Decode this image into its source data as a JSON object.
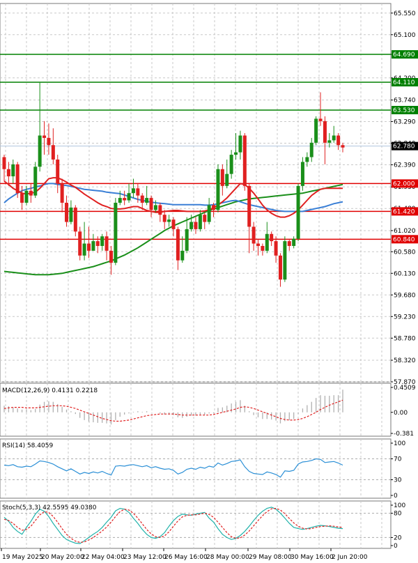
{
  "chart_data": {
    "type": "candlestick",
    "title": "",
    "price_axis": {
      "ticks": [
        "65.550",
        "65.100",
        "64.690",
        "64.200",
        "63.740",
        "63.290",
        "62.840",
        "62.390",
        "61.930",
        "61.480",
        "61.020",
        "60.580",
        "60.130",
        "59.680",
        "59.230",
        "58.780",
        "58.320",
        "57.870"
      ],
      "ylim": [
        57.87,
        65.75
      ]
    },
    "time_axis": {
      "labels": [
        "19 May 2025",
        "20 May 20:00",
        "22 May 04:00",
        "23 May 12:00",
        "26 May 16:00",
        "28 May 00:00",
        "29 May 08:00",
        "30 May 16:00",
        "2 Jun 20:00"
      ]
    },
    "horizontal_levels": [
      {
        "value": 64.69,
        "label": "64.690",
        "color": "#008000"
      },
      {
        "value": 64.11,
        "label": "64.110",
        "color": "#008000"
      },
      {
        "value": 63.53,
        "label": "63.530",
        "color": "#008000"
      },
      {
        "value": 62.0,
        "label": "62.000",
        "color": "#e00000"
      },
      {
        "value": 61.42,
        "label": "61.420",
        "color": "#e00000"
      },
      {
        "value": 60.84,
        "label": "60.840",
        "color": "#e00000"
      }
    ],
    "current_price": {
      "value": 62.78,
      "label": "62.780"
    },
    "candles": [
      [
        62.55,
        62.3,
        62.6,
        62.05
      ],
      [
        62.3,
        62.15,
        62.45,
        61.95
      ],
      [
        62.15,
        62.4,
        62.5,
        62.0
      ],
      [
        62.4,
        61.8,
        62.45,
        61.7
      ],
      [
        61.8,
        61.6,
        61.95,
        61.45
      ],
      [
        61.6,
        61.85,
        61.95,
        61.55
      ],
      [
        61.85,
        61.75,
        62.0,
        61.6
      ],
      [
        61.75,
        62.35,
        62.45,
        61.7
      ],
      [
        62.35,
        63.0,
        64.1,
        62.25
      ],
      [
        63.0,
        62.95,
        63.3,
        62.6
      ],
      [
        62.95,
        62.8,
        63.25,
        62.6
      ],
      [
        62.8,
        62.5,
        63.15,
        62.4
      ],
      [
        62.5,
        62.0,
        62.6,
        61.8
      ],
      [
        62.0,
        61.6,
        62.1,
        61.4
      ],
      [
        61.6,
        61.2,
        61.75,
        61.1
      ],
      [
        61.2,
        61.5,
        61.65,
        61.15
      ],
      [
        61.5,
        61.0,
        61.55,
        60.9
      ],
      [
        61.0,
        60.5,
        61.1,
        60.4
      ],
      [
        60.5,
        60.75,
        61.2,
        60.4
      ],
      [
        60.75,
        60.6,
        61.1,
        60.45
      ],
      [
        60.6,
        60.8,
        60.95,
        60.6
      ],
      [
        60.8,
        60.7,
        60.9,
        60.55
      ],
      [
        60.7,
        60.9,
        60.95,
        60.6
      ],
      [
        60.9,
        60.6,
        61.0,
        60.4
      ],
      [
        60.6,
        60.35,
        60.7,
        60.1
      ],
      [
        60.35,
        61.6,
        61.7,
        60.3
      ],
      [
        61.6,
        61.7,
        61.85,
        61.55
      ],
      [
        61.7,
        61.65,
        61.85,
        61.55
      ],
      [
        61.65,
        61.8,
        62.0,
        61.6
      ],
      [
        61.8,
        61.9,
        62.1,
        61.7
      ],
      [
        61.9,
        61.75,
        62.0,
        61.6
      ],
      [
        61.75,
        61.6,
        61.8,
        61.45
      ],
      [
        61.6,
        61.7,
        61.95,
        61.55
      ],
      [
        61.7,
        61.45,
        61.75,
        61.3
      ],
      [
        61.45,
        61.55,
        61.65,
        61.4
      ],
      [
        61.55,
        61.35,
        61.6,
        61.2
      ],
      [
        61.35,
        61.2,
        61.45,
        61.05
      ],
      [
        61.2,
        61.25,
        61.35,
        61.1
      ],
      [
        61.25,
        61.05,
        61.3,
        60.9
      ],
      [
        61.05,
        60.4,
        61.1,
        60.2
      ],
      [
        60.4,
        60.6,
        60.9,
        60.35
      ],
      [
        60.6,
        61.05,
        61.3,
        60.55
      ],
      [
        61.05,
        61.2,
        61.35,
        61.0
      ],
      [
        61.2,
        61.05,
        61.3,
        60.95
      ],
      [
        61.05,
        61.35,
        61.45,
        61.0
      ],
      [
        61.35,
        61.2,
        61.4,
        61.05
      ],
      [
        61.2,
        61.55,
        61.7,
        61.15
      ],
      [
        61.55,
        61.45,
        61.6,
        61.3
      ],
      [
        61.45,
        62.3,
        62.4,
        61.4
      ],
      [
        62.3,
        61.95,
        62.4,
        61.75
      ],
      [
        61.95,
        62.2,
        62.5,
        61.9
      ],
      [
        62.2,
        62.6,
        62.7,
        62.1
      ],
      [
        62.6,
        62.65,
        63.05,
        62.5
      ],
      [
        62.65,
        63.0,
        63.1,
        62.5
      ],
      [
        63.0,
        61.95,
        63.05,
        61.85
      ],
      [
        61.95,
        61.1,
        62.0,
        60.55
      ],
      [
        61.1,
        60.75,
        61.2,
        60.6
      ],
      [
        60.75,
        60.7,
        60.85,
        60.5
      ],
      [
        60.7,
        60.6,
        60.75,
        60.5
      ],
      [
        60.6,
        60.95,
        61.2,
        60.55
      ],
      [
        60.95,
        60.8,
        61.0,
        60.7
      ],
      [
        60.8,
        60.5,
        60.9,
        60.35
      ],
      [
        60.5,
        60.0,
        60.55,
        59.85
      ],
      [
        60.0,
        60.8,
        60.9,
        59.95
      ],
      [
        60.8,
        60.7,
        60.85,
        60.6
      ],
      [
        60.7,
        60.85,
        60.9,
        60.65
      ],
      [
        60.85,
        61.95,
        62.0,
        60.8
      ],
      [
        61.95,
        62.45,
        62.55,
        61.85
      ],
      [
        62.45,
        62.55,
        62.65,
        62.35
      ],
      [
        62.55,
        62.85,
        62.95,
        62.45
      ],
      [
        62.85,
        63.35,
        63.4,
        62.8
      ],
      [
        63.35,
        63.3,
        63.9,
        63.2
      ],
      [
        63.3,
        62.85,
        63.4,
        62.4
      ],
      [
        62.85,
        62.9,
        63.05,
        62.75
      ],
      [
        62.9,
        63.0,
        63.2,
        62.85
      ],
      [
        63.0,
        62.8,
        63.05,
        62.7
      ],
      [
        62.8,
        62.75,
        62.85,
        62.65
      ]
    ],
    "sma_fast_red": [
      62.05,
      61.98,
      61.9,
      61.85,
      61.8,
      61.78,
      61.8,
      61.82,
      61.9,
      62.0,
      62.1,
      62.12,
      62.12,
      62.08,
      62.03,
      61.97,
      61.92,
      61.85,
      61.78,
      61.72,
      61.66,
      61.6,
      61.55,
      61.52,
      61.48,
      61.47,
      61.47,
      61.48,
      61.5,
      61.52,
      61.52,
      61.48,
      61.44,
      61.42,
      61.4,
      61.4,
      61.42,
      61.43,
      61.44,
      61.44,
      61.43,
      61.42,
      61.42,
      61.42,
      61.42,
      61.43,
      61.45,
      61.5,
      61.55,
      61.62,
      61.7,
      61.8,
      61.9,
      62.0,
      61.98,
      61.9,
      61.8,
      61.68,
      61.55,
      61.45,
      61.38,
      61.33,
      61.3,
      61.3,
      61.33,
      61.38,
      61.45,
      61.55,
      61.65,
      61.75,
      61.82,
      61.88,
      61.9,
      61.9,
      61.9,
      61.9,
      61.9
    ],
    "sma_mid_blue": [
      61.6,
      61.68,
      61.74,
      61.8,
      61.85,
      61.88,
      61.9,
      61.93,
      61.95,
      61.98,
      62.0,
      62.0,
      61.98,
      61.97,
      61.96,
      61.94,
      61.92,
      61.9,
      61.88,
      61.87,
      61.86,
      61.85,
      61.84,
      61.82,
      61.81,
      61.8,
      61.79,
      61.76,
      61.73,
      61.7,
      61.67,
      61.65,
      61.63,
      61.61,
      61.6,
      61.59,
      61.58,
      61.57,
      61.56,
      61.56,
      61.56,
      61.56,
      61.56,
      61.56,
      61.56,
      61.55,
      61.55,
      61.56,
      61.58,
      61.6,
      61.62,
      61.64,
      61.65,
      61.62,
      61.59,
      61.56,
      61.54,
      61.52,
      61.5,
      61.48,
      61.46,
      61.44,
      61.43,
      61.42,
      61.42,
      61.42,
      61.42,
      61.42,
      61.44,
      61.46,
      61.48,
      61.5,
      61.52,
      61.55,
      61.58,
      61.6,
      61.62
    ],
    "sma_slow_green": [
      60.17,
      60.16,
      60.15,
      60.14,
      60.13,
      60.12,
      60.11,
      60.1,
      60.1,
      60.1,
      60.1,
      60.11,
      60.12,
      60.13,
      60.15,
      60.17,
      60.19,
      60.21,
      60.23,
      60.25,
      60.27,
      60.3,
      60.33,
      60.36,
      60.39,
      60.43,
      60.47,
      60.51,
      60.56,
      60.61,
      60.66,
      60.72,
      60.78,
      60.84,
      60.9,
      60.96,
      61.02,
      61.07,
      61.12,
      61.16,
      61.2,
      61.24,
      61.28,
      61.32,
      61.36,
      61.4,
      61.44,
      61.47,
      61.5,
      61.53,
      61.56,
      61.59,
      61.62,
      61.64,
      61.66,
      61.68,
      61.69,
      61.7,
      61.71,
      61.72,
      61.73,
      61.74,
      61.75,
      61.76,
      61.77,
      61.78,
      61.79,
      61.8,
      61.82,
      61.84,
      61.86,
      61.88,
      61.9,
      61.92,
      61.94,
      61.96,
      61.98
    ],
    "macd": {
      "label": "MACD(12,26,9) 0.4131 0.2218",
      "ticks": [
        "0.4509",
        "0.00",
        "-0.381"
      ],
      "ylim": [
        -0.381,
        0.4509
      ],
      "histogram": [
        0.12,
        0.11,
        0.09,
        0.07,
        0.05,
        0.05,
        0.04,
        0.06,
        0.14,
        0.19,
        0.2,
        0.19,
        0.15,
        0.1,
        0.05,
        0.02,
        -0.03,
        -0.1,
        -0.14,
        -0.17,
        -0.18,
        -0.19,
        -0.19,
        -0.2,
        -0.22,
        -0.14,
        -0.08,
        -0.04,
        -0.02,
        0.01,
        0.02,
        0.01,
        0.02,
        0.0,
        0.0,
        -0.02,
        -0.04,
        -0.04,
        -0.05,
        -0.09,
        -0.1,
        -0.08,
        -0.06,
        -0.06,
        -0.04,
        -0.04,
        -0.02,
        -0.02,
        0.08,
        0.09,
        0.12,
        0.16,
        0.19,
        0.22,
        0.12,
        0.02,
        -0.05,
        -0.09,
        -0.12,
        -0.12,
        -0.13,
        -0.15,
        -0.2,
        -0.16,
        -0.14,
        -0.12,
        -0.03,
        0.07,
        0.13,
        0.19,
        0.26,
        0.31,
        0.3,
        0.3,
        0.31,
        0.31,
        0.41
      ],
      "signal": [
        0.07,
        0.08,
        0.09,
        0.09,
        0.09,
        0.08,
        0.08,
        0.08,
        0.09,
        0.1,
        0.11,
        0.12,
        0.12,
        0.12,
        0.11,
        0.09,
        0.07,
        0.04,
        0.01,
        -0.02,
        -0.05,
        -0.08,
        -0.11,
        -0.13,
        -0.15,
        -0.16,
        -0.16,
        -0.15,
        -0.14,
        -0.12,
        -0.1,
        -0.08,
        -0.06,
        -0.05,
        -0.04,
        -0.03,
        -0.03,
        -0.03,
        -0.03,
        -0.04,
        -0.05,
        -0.05,
        -0.05,
        -0.05,
        -0.05,
        -0.05,
        -0.05,
        -0.04,
        -0.02,
        0.0,
        0.02,
        0.04,
        0.06,
        0.09,
        0.1,
        0.09,
        0.07,
        0.04,
        0.01,
        -0.02,
        -0.05,
        -0.08,
        -0.11,
        -0.13,
        -0.14,
        -0.14,
        -0.13,
        -0.11,
        -0.08,
        -0.04,
        0.0,
        0.05,
        0.09,
        0.13,
        0.16,
        0.19,
        0.22
      ]
    },
    "rsi": {
      "label": "RSI(14) 58.4059",
      "ticks": [
        "100",
        "70",
        "30",
        "0"
      ],
      "ylim": [
        0,
        100
      ],
      "values": [
        58,
        57,
        59,
        55,
        54,
        56,
        55,
        60,
        66,
        65,
        63,
        60,
        55,
        51,
        47,
        51,
        46,
        41,
        44,
        42,
        45,
        43,
        46,
        42,
        39,
        56,
        57,
        56,
        58,
        59,
        57,
        55,
        57,
        53,
        55,
        52,
        50,
        51,
        48,
        41,
        44,
        50,
        52,
        50,
        54,
        52,
        56,
        54,
        62,
        58,
        61,
        65,
        66,
        68,
        55,
        46,
        42,
        41,
        40,
        45,
        43,
        40,
        35,
        47,
        46,
        48,
        60,
        64,
        65,
        67,
        70,
        69,
        63,
        64,
        65,
        62,
        58
      ]
    },
    "stoch": {
      "label": "Stoch(5,3,3) 42.5595 49.0380",
      "ticks": [
        "100",
        "80",
        "20",
        "0"
      ],
      "ylim": [
        0,
        100
      ],
      "k": [
        70,
        60,
        45,
        35,
        28,
        45,
        60,
        78,
        90,
        85,
        72,
        55,
        40,
        25,
        15,
        10,
        6,
        5,
        12,
        20,
        28,
        35,
        45,
        58,
        70,
        86,
        92,
        90,
        82,
        68,
        55,
        40,
        28,
        20,
        18,
        22,
        32,
        48,
        62,
        72,
        78,
        76,
        75,
        78,
        80,
        82,
        68,
        58,
        42,
        28,
        20,
        15,
        18,
        25,
        35,
        48,
        62,
        75,
        85,
        92,
        95,
        90,
        80,
        68,
        55,
        45,
        42,
        40,
        42,
        45,
        48,
        50,
        49,
        47,
        45,
        43,
        42
      ],
      "d": [
        65,
        62,
        55,
        45,
        38,
        40,
        48,
        62,
        76,
        84,
        82,
        72,
        58,
        42,
        28,
        18,
        11,
        8,
        9,
        14,
        20,
        28,
        36,
        46,
        58,
        72,
        84,
        90,
        88,
        80,
        68,
        54,
        40,
        29,
        22,
        20,
        24,
        34,
        48,
        61,
        71,
        75,
        76,
        76,
        78,
        80,
        77,
        70,
        58,
        45,
        32,
        22,
        18,
        19,
        26,
        36,
        49,
        62,
        74,
        84,
        91,
        92,
        88,
        79,
        67,
        56,
        48,
        43,
        41,
        42,
        45,
        47,
        48,
        49,
        48,
        46,
        45
      ]
    }
  }
}
